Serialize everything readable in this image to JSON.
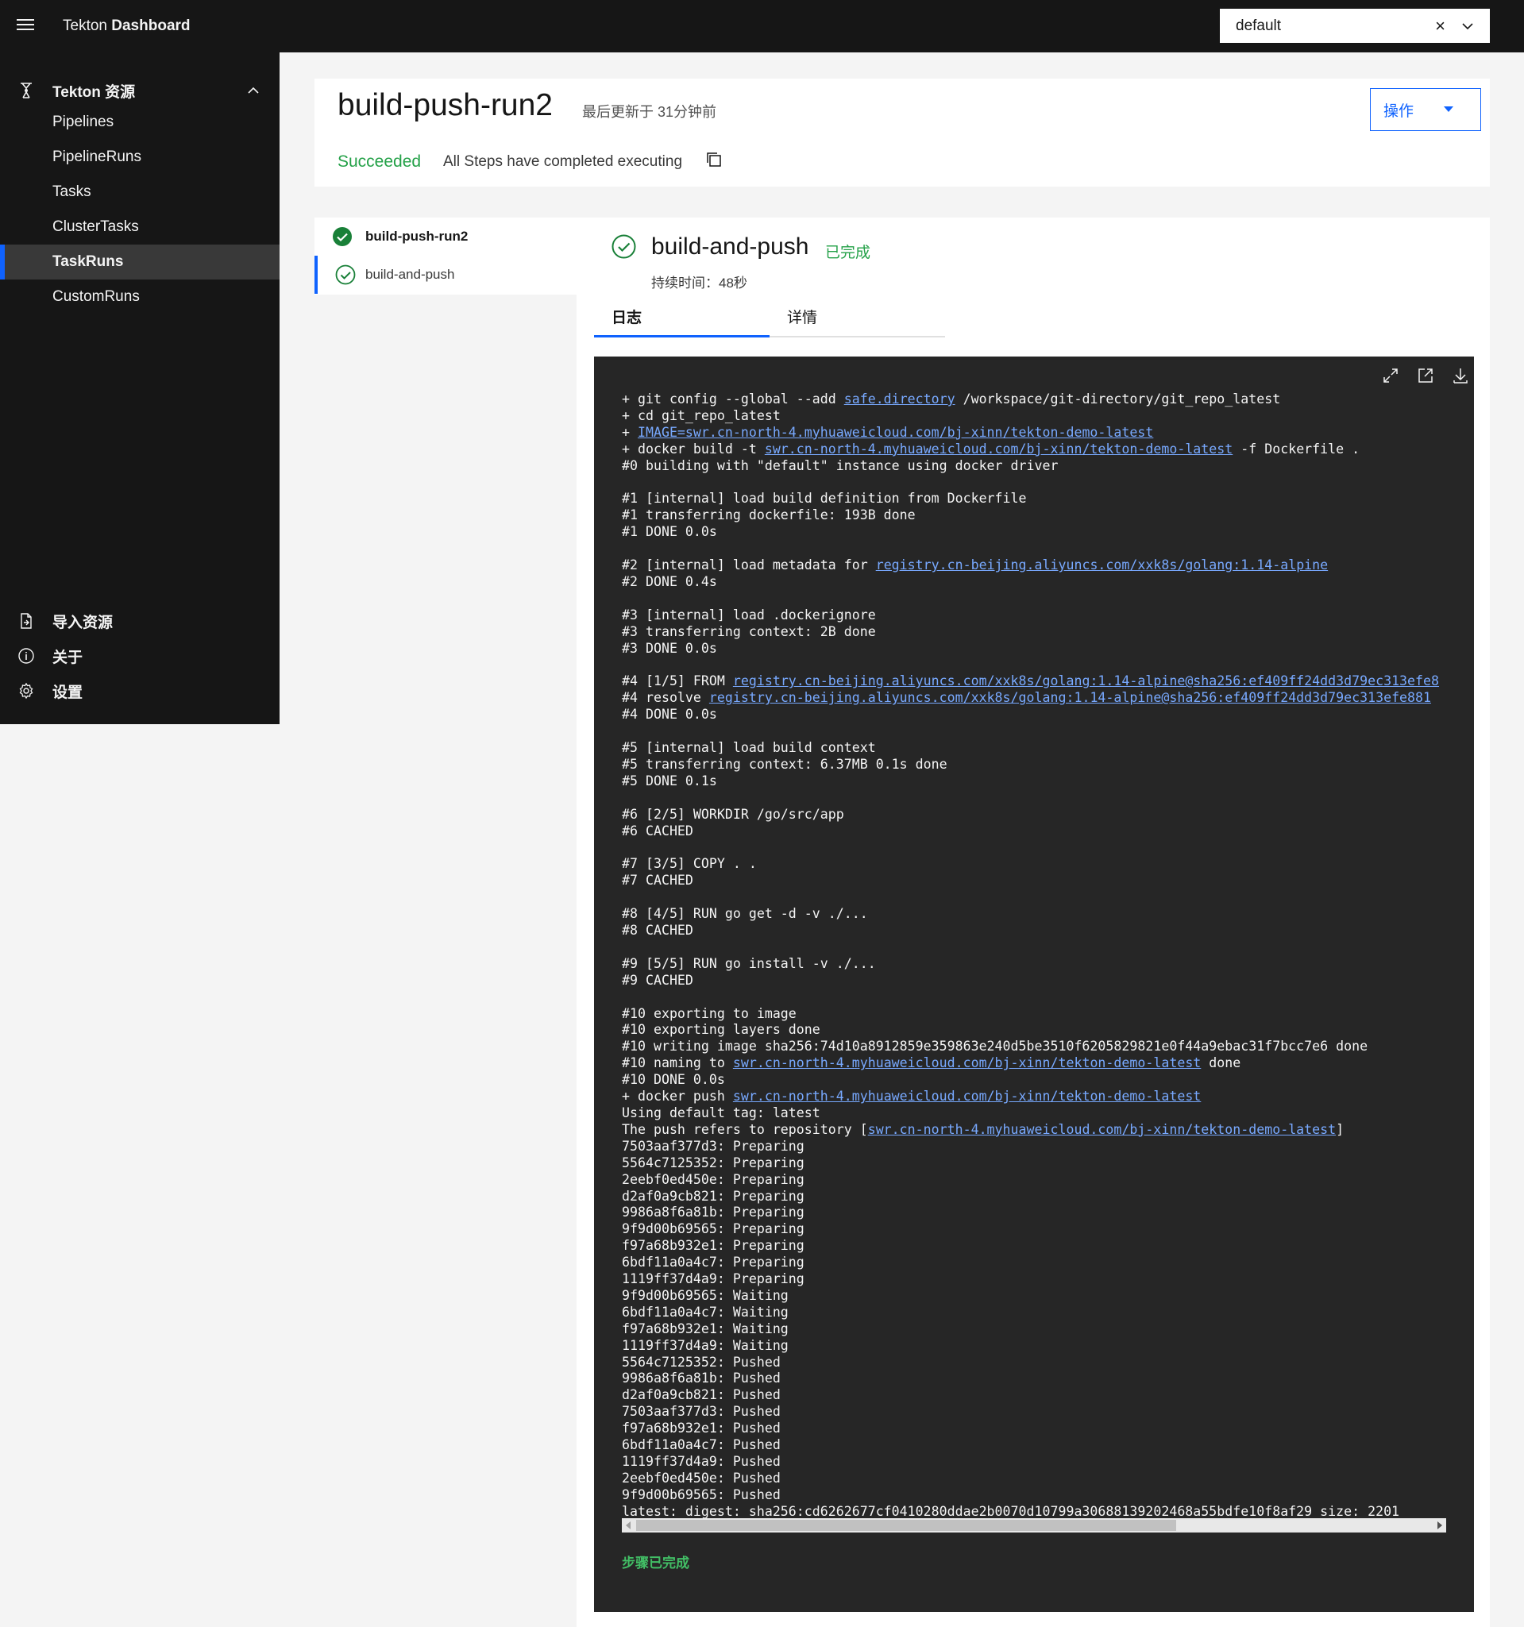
{
  "header": {
    "brand_main": "Tekton",
    "brand_bold": "Dashboard",
    "namespace": "default",
    "clear_icon": "×"
  },
  "sidebar": {
    "section_label": "Tekton 资源",
    "items": [
      "Pipelines",
      "PipelineRuns",
      "Tasks",
      "ClusterTasks",
      "TaskRuns",
      "CustomRuns"
    ],
    "active_item": "TaskRuns",
    "bottom": [
      "导入资源",
      "关于",
      "设置"
    ]
  },
  "run": {
    "title": "build-push-run2",
    "updated": "最后更新于 31分钟前",
    "status": "Succeeded",
    "status_message": "All Steps have completed executing",
    "actions_label": "操作"
  },
  "tree": {
    "run_name": "build-push-run2",
    "task_name": "build-and-push"
  },
  "step": {
    "title": "build-and-push",
    "status": "已完成",
    "duration": "持续时间：48秒",
    "tabs": [
      "日志",
      "详情"
    ]
  },
  "log": {
    "lines": [
      [
        "+ git config --global --add ",
        {
          "link": "safe.directory"
        },
        " /workspace/git-directory/git_repo_latest"
      ],
      [
        "+ cd git_repo_latest"
      ],
      [
        "+ ",
        {
          "link": "IMAGE=swr.cn-north-4.myhuaweicloud.com/bj-xinn/tekton-demo-latest"
        }
      ],
      [
        "+ docker build -t ",
        {
          "link": "swr.cn-north-4.myhuaweicloud.com/bj-xinn/tekton-demo-latest"
        },
        " -f Dockerfile ."
      ],
      [
        "#0 building with \"default\" instance using docker driver"
      ],
      [
        ""
      ],
      [
        "#1 [internal] load build definition from Dockerfile"
      ],
      [
        "#1 transferring dockerfile: 193B done"
      ],
      [
        "#1 DONE 0.0s"
      ],
      [
        ""
      ],
      [
        "#2 [internal] load metadata for ",
        {
          "link": "registry.cn-beijing.aliyuncs.com/xxk8s/golang:1.14-alpine"
        }
      ],
      [
        "#2 DONE 0.4s"
      ],
      [
        ""
      ],
      [
        "#3 [internal] load .dockerignore"
      ],
      [
        "#3 transferring context: 2B done"
      ],
      [
        "#3 DONE 0.0s"
      ],
      [
        ""
      ],
      [
        "#4 [1/5] FROM ",
        {
          "link": "registry.cn-beijing.aliyuncs.com/xxk8s/golang:1.14-alpine@sha256:ef409ff24dd3d79ec313efe8"
        }
      ],
      [
        "#4 resolve ",
        {
          "link": "registry.cn-beijing.aliyuncs.com/xxk8s/golang:1.14-alpine@sha256:ef409ff24dd3d79ec313efe881"
        }
      ],
      [
        "#4 DONE 0.0s"
      ],
      [
        ""
      ],
      [
        "#5 [internal] load build context"
      ],
      [
        "#5 transferring context: 6.37MB 0.1s done"
      ],
      [
        "#5 DONE 0.1s"
      ],
      [
        ""
      ],
      [
        "#6 [2/5] WORKDIR /go/src/app"
      ],
      [
        "#6 CACHED"
      ],
      [
        ""
      ],
      [
        "#7 [3/5] COPY . ."
      ],
      [
        "#7 CACHED"
      ],
      [
        ""
      ],
      [
        "#8 [4/5] RUN go get -d -v ./..."
      ],
      [
        "#8 CACHED"
      ],
      [
        ""
      ],
      [
        "#9 [5/5] RUN go install -v ./..."
      ],
      [
        "#9 CACHED"
      ],
      [
        ""
      ],
      [
        "#10 exporting to image"
      ],
      [
        "#10 exporting layers done"
      ],
      [
        "#10 writing image sha256:74d10a8912859e359863e240d5be3510f6205829821e0f44a9ebac31f7bcc7e6 done"
      ],
      [
        "#10 naming to ",
        {
          "link": "swr.cn-north-4.myhuaweicloud.com/bj-xinn/tekton-demo-latest"
        },
        " done"
      ],
      [
        "#10 DONE 0.0s"
      ],
      [
        "+ docker push ",
        {
          "link": "swr.cn-north-4.myhuaweicloud.com/bj-xinn/tekton-demo-latest"
        }
      ],
      [
        "Using default tag: latest"
      ],
      [
        "The push refers to repository [",
        {
          "link": "swr.cn-north-4.myhuaweicloud.com/bj-xinn/tekton-demo-latest"
        },
        "]"
      ],
      [
        "7503aaf377d3: Preparing"
      ],
      [
        "5564c7125352: Preparing"
      ],
      [
        "2eebf0ed450e: Preparing"
      ],
      [
        "d2af0a9cb821: Preparing"
      ],
      [
        "9986a8f6a81b: Preparing"
      ],
      [
        "9f9d00b69565: Preparing"
      ],
      [
        "f97a68b932e1: Preparing"
      ],
      [
        "6bdf11a0a4c7: Preparing"
      ],
      [
        "1119ff37d4a9: Preparing"
      ],
      [
        "9f9d00b69565: Waiting"
      ],
      [
        "6bdf11a0a4c7: Waiting"
      ],
      [
        "f97a68b932e1: Waiting"
      ],
      [
        "1119ff37d4a9: Waiting"
      ],
      [
        "5564c7125352: Pushed"
      ],
      [
        "9986a8f6a81b: Pushed"
      ],
      [
        "d2af0a9cb821: Pushed"
      ],
      [
        "7503aaf377d3: Pushed"
      ],
      [
        "f97a68b932e1: Pushed"
      ],
      [
        "6bdf11a0a4c7: Pushed"
      ],
      [
        "1119ff37d4a9: Pushed"
      ],
      [
        "2eebf0ed450e: Pushed"
      ],
      [
        "9f9d00b69565: Pushed"
      ],
      [
        "latest: digest: sha256:cd6262677cf0410280ddae2b0070d10799a30688139202468a55bdfe10f8af29 size: 2201"
      ]
    ],
    "footer": "步骤已完成"
  },
  "colors": {
    "accent": "#0f62fe",
    "success": "#24a148",
    "link": "#78a9ff"
  }
}
